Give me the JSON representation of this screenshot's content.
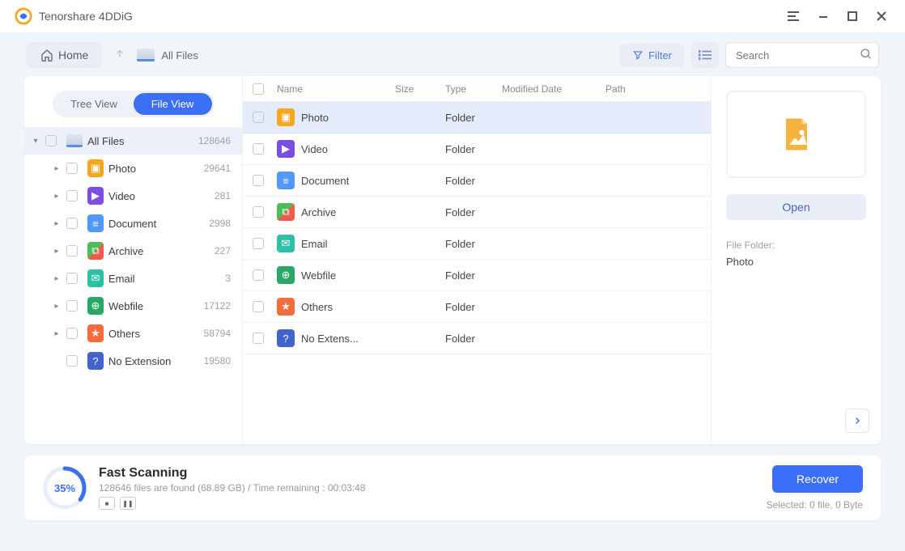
{
  "app_title": "Tenorshare 4DDiG",
  "toolbar": {
    "home": "Home",
    "breadcrumb": "All Files",
    "filter": "Filter",
    "search_placeholder": "Search"
  },
  "view_toggle": {
    "tree": "Tree View",
    "file": "File View"
  },
  "tree": {
    "root": {
      "label": "All Files",
      "count": "128646"
    },
    "items": [
      {
        "label": "Photo",
        "count": "29641",
        "icon": "photo"
      },
      {
        "label": "Video",
        "count": "281",
        "icon": "video"
      },
      {
        "label": "Document",
        "count": "2998",
        "icon": "document"
      },
      {
        "label": "Archive",
        "count": "227",
        "icon": "archive"
      },
      {
        "label": "Email",
        "count": "3",
        "icon": "email"
      },
      {
        "label": "Webfile",
        "count": "17122",
        "icon": "webfile"
      },
      {
        "label": "Others",
        "count": "58794",
        "icon": "others"
      },
      {
        "label": "No Extension",
        "count": "19580",
        "icon": "noext",
        "leaf": true
      }
    ]
  },
  "table": {
    "headers": {
      "name": "Name",
      "size": "Size",
      "type": "Type",
      "modified": "Modified Date",
      "path": "Path"
    },
    "rows": [
      {
        "name": "Photo",
        "type": "Folder",
        "icon": "photo",
        "selected": true
      },
      {
        "name": "Video",
        "type": "Folder",
        "icon": "video"
      },
      {
        "name": "Document",
        "type": "Folder",
        "icon": "document"
      },
      {
        "name": "Archive",
        "type": "Folder",
        "icon": "archive"
      },
      {
        "name": "Email",
        "type": "Folder",
        "icon": "email"
      },
      {
        "name": "Webfile",
        "type": "Folder",
        "icon": "webfile"
      },
      {
        "name": "Others",
        "type": "Folder",
        "icon": "others"
      },
      {
        "name": "No Extens...",
        "type": "Folder",
        "icon": "noext"
      }
    ]
  },
  "preview": {
    "open": "Open",
    "meta_label": "File Folder:",
    "meta_value": "Photo"
  },
  "scan": {
    "percent": "35%",
    "title": "Fast Scanning",
    "details": "128646 files are found (68.89 GB) /  Time remaining : 00:03:48",
    "recover": "Recover",
    "selected_info": "Selected: 0 file, 0 Byte"
  }
}
